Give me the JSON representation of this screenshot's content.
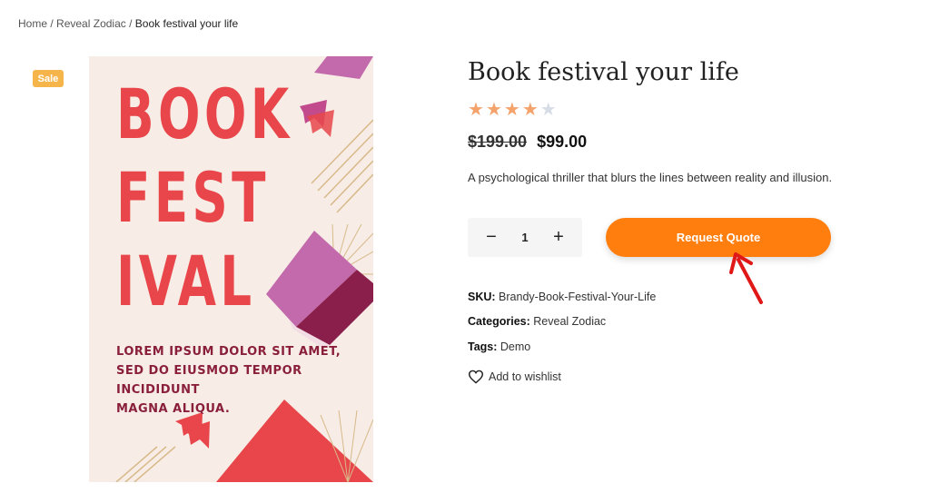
{
  "breadcrumb": {
    "home": "Home",
    "category": "Reveal Zodiac",
    "current": "Book festival your life",
    "separator": "/"
  },
  "badge": {
    "sale": "Sale"
  },
  "cover": {
    "title_lines": [
      "BOOK",
      "FEST",
      "IVAL"
    ],
    "lorem_lines": [
      "LOREM IPSUM DOLOR SIT AMET,",
      "SED DO EIUSMOD TEMPOR INCIDIDUNT",
      "MAGNA ALIQUA."
    ]
  },
  "product": {
    "title": "Book festival your life",
    "rating": {
      "value": 4,
      "max": 5
    },
    "old_price": "$199.00",
    "price": "$99.00",
    "description": "A psychological thriller that blurs the lines between reality and illusion."
  },
  "quantity": {
    "value": "1",
    "minus": "−",
    "plus": "+"
  },
  "actions": {
    "request_quote": "Request Quote",
    "wishlist": "Add to wishlist"
  },
  "meta": {
    "sku_label": "SKU:",
    "sku": "Brandy-Book-Festival-Your-Life",
    "categories_label": "Categories:",
    "categories": "Reveal Zodiac",
    "tags_label": "Tags:",
    "tags": "Demo"
  },
  "colors": {
    "accent": "#ff7e0e",
    "star": "#f5a26b",
    "star_empty": "#d7dde6",
    "sale": "#f5b54a",
    "cover_red": "#e8464a"
  },
  "icons": {
    "heart": "heart-icon",
    "star": "star-icon",
    "arrow": "red-arrow-annotation"
  }
}
